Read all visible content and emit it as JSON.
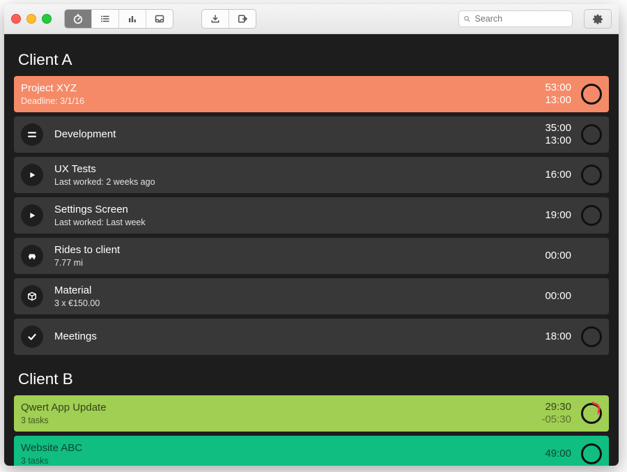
{
  "search": {
    "placeholder": "Search"
  },
  "sections": {
    "clientA": "Client A",
    "clientB": "Client B"
  },
  "rows": {
    "projectXYZ": {
      "title": "Project XYZ",
      "sub": "Deadline: 3/1/16",
      "t1": "53:00",
      "t2": "13:00"
    },
    "development": {
      "title": "Development",
      "t1": "35:00",
      "t2": "13:00"
    },
    "uxtests": {
      "title": "UX Tests",
      "sub": "Last worked: 2 weeks ago",
      "t1": "16:00"
    },
    "settings": {
      "title": "Settings Screen",
      "sub": "Last worked: Last week",
      "t1": "19:00"
    },
    "rides": {
      "title": "Rides to client",
      "sub": "7.77 mi",
      "t1": "00:00"
    },
    "material": {
      "title": "Material",
      "sub": "3 x €150.00",
      "t1": "00:00"
    },
    "meetings": {
      "title": "Meetings",
      "t1": "18:00"
    },
    "qwert": {
      "title": "Qwert App Update",
      "sub": "3 tasks",
      "t1": "29:30",
      "t2": "-05:30"
    },
    "website": {
      "title": "Website ABC",
      "sub": "3 tasks",
      "t1": "49:00"
    }
  }
}
